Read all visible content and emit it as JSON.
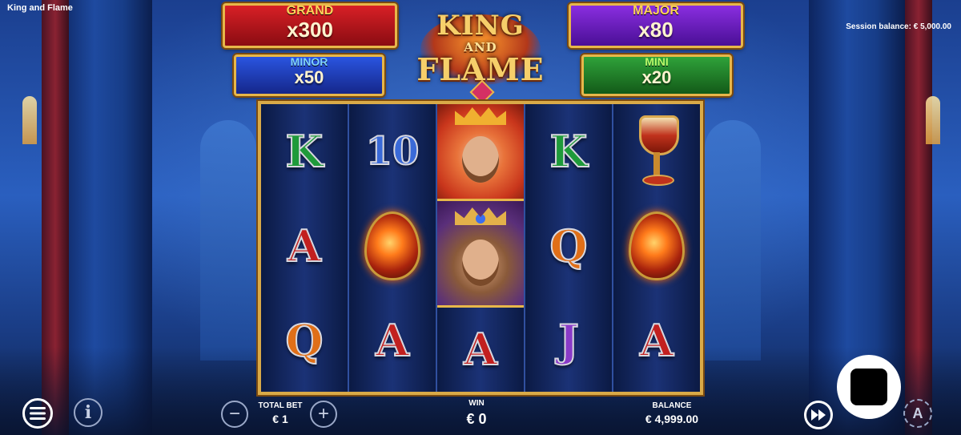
{
  "window": {
    "title": "King and Flame"
  },
  "session": {
    "text": "Session balance: € 5,000.00"
  },
  "jackpots": {
    "grand": {
      "name": "GRAND",
      "value": "x300",
      "color": "#b8141c"
    },
    "major": {
      "name": "MAJOR",
      "value": "x80",
      "color": "#6a1fb8"
    },
    "minor": {
      "name": "MINOR",
      "value": "x50",
      "color": "#1f3fc4"
    },
    "mini": {
      "name": "MINI",
      "value": "x20",
      "color": "#1f8a2a"
    }
  },
  "logo": {
    "line1": "KING",
    "line2": "AND",
    "line3": "FLAME"
  },
  "reels": [
    {
      "symbols": [
        "K",
        "A",
        "Q"
      ],
      "colors": [
        "#1f9a3a",
        "#c2201f",
        "#e06f18"
      ]
    },
    {
      "symbols": [
        "10",
        "fire-egg",
        "A"
      ],
      "colors": [
        "#3a6ad8",
        "",
        "#c2201f"
      ]
    },
    {
      "symbols": [
        "queen-wild",
        "king-wild",
        "A"
      ],
      "colors": [
        "",
        "",
        "#c2201f"
      ]
    },
    {
      "symbols": [
        "K",
        "Q",
        "J"
      ],
      "colors": [
        "#1f9a3a",
        "#e06f18",
        "#8a3ac8"
      ]
    },
    {
      "symbols": [
        "goblet",
        "fire-egg",
        "A"
      ],
      "colors": [
        "",
        "",
        "#c2201f"
      ]
    }
  ],
  "controls": {
    "total_bet_label": "TOTAL BET",
    "total_bet_value": "€ 1",
    "win_label": "WIN",
    "win_value": "€ 0",
    "balance_label": "BALANCE",
    "balance_value": "€ 4,999.00",
    "minus": "−",
    "plus": "+",
    "info": "i",
    "auto": "A"
  }
}
